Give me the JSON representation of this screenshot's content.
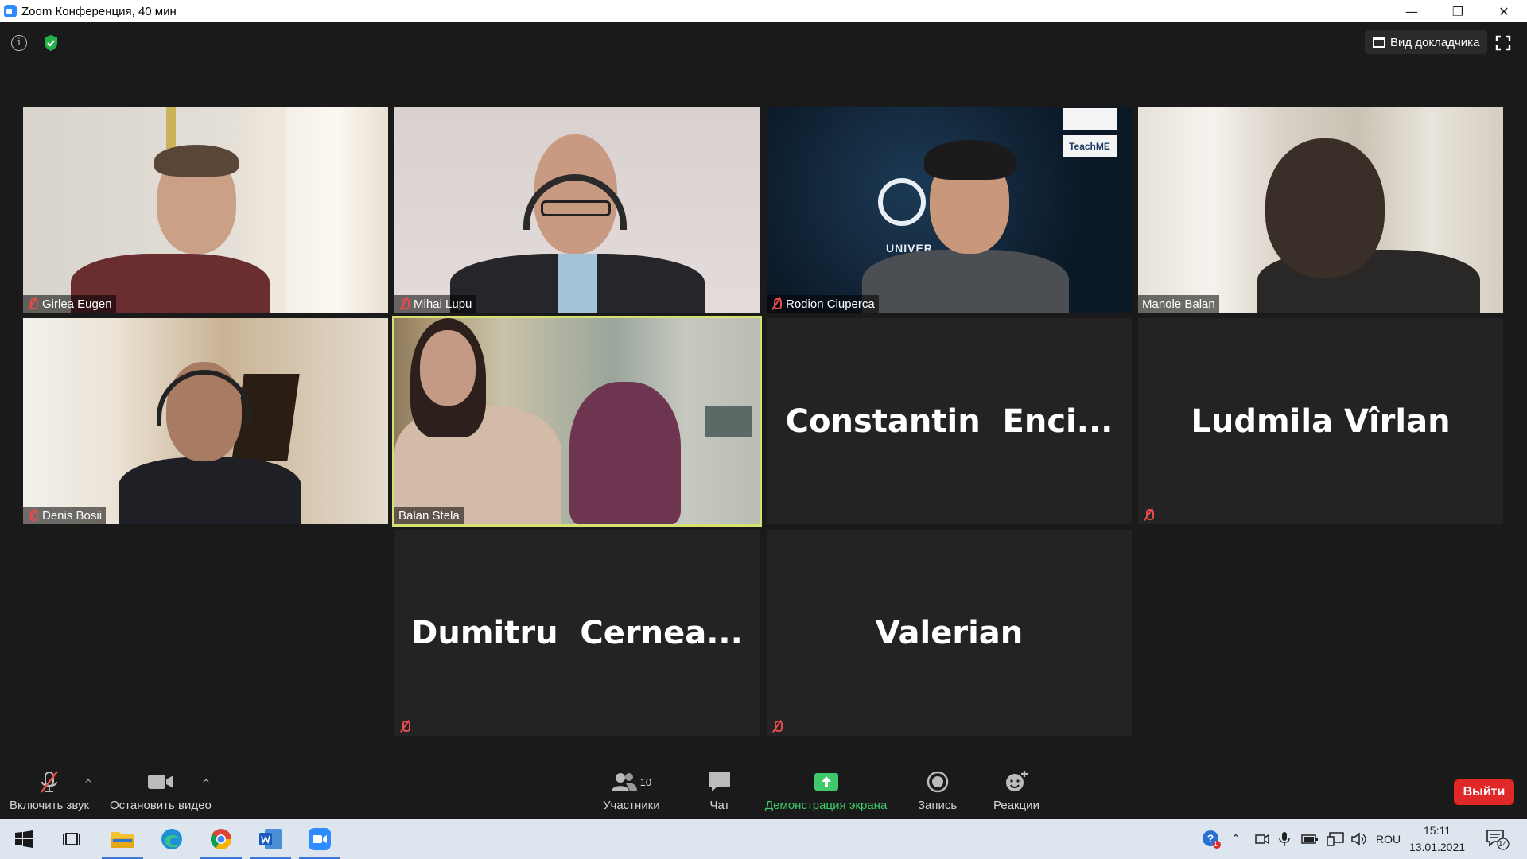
{
  "window": {
    "title": "Zoom Конференция, 40 мин",
    "minimize": "—",
    "restore": "❐",
    "close": "✕"
  },
  "topbar": {
    "info": "i",
    "speaker_view_label": "Вид докладчика"
  },
  "participants": [
    {
      "name": "Girlea Eugen",
      "muted": true,
      "video": true
    },
    {
      "name": "Mihai Lupu",
      "muted": true,
      "video": true
    },
    {
      "name": "Rodion Ciuperca",
      "muted": true,
      "video": true
    },
    {
      "name": "Manole Balan",
      "muted": false,
      "video": true
    },
    {
      "name": "Denis Bosii",
      "muted": true,
      "video": true
    },
    {
      "name": "Balan Stela",
      "muted": false,
      "video": true,
      "active_speaker": true
    },
    {
      "display_name": "Constantin  Enci...",
      "muted": false,
      "video": false
    },
    {
      "display_name": "Ludmila Vîrlan",
      "muted": true,
      "video": false
    },
    {
      "display_name": "Dumitru  Cernea...",
      "muted": true,
      "video": false
    },
    {
      "display_name": "Valerian",
      "muted": true,
      "video": false
    }
  ],
  "video_overlay_text": {
    "logo1": "TeachME",
    "logo2": "UNIVER"
  },
  "toolbar": {
    "unmute_label": "Включить звук",
    "stop_video_label": "Остановить видео",
    "participants_label": "Участники",
    "participants_count": "10",
    "chat_label": "Чат",
    "share_label": "Демонстрация экрана",
    "record_label": "Запись",
    "reactions_label": "Реакции",
    "leave_label": "Выйти",
    "caret": "^"
  },
  "taskbar": {
    "language": "ROU",
    "time": "15:11",
    "date": "13.01.2021",
    "notifications_count": "14",
    "help_badge": "1"
  },
  "colors": {
    "zoom_blue": "#2d8cff",
    "muted_red": "#e24c4c",
    "active_speaker_outline": "#d6e070",
    "share_green": "#3ec96b",
    "leave_red": "#e02828"
  }
}
